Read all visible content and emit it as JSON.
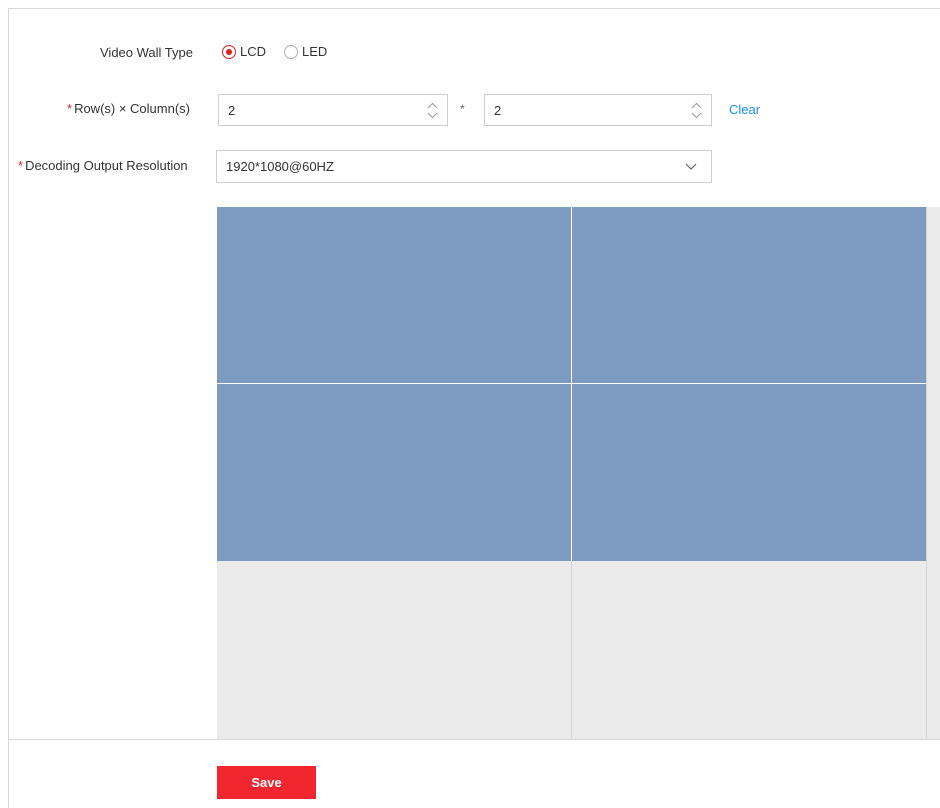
{
  "form": {
    "video_wall_type": {
      "label": "Video Wall Type",
      "options": [
        {
          "label": "LCD",
          "checked": true
        },
        {
          "label": "LED",
          "checked": false
        }
      ]
    },
    "rows_columns": {
      "required_mark": "*",
      "label": "Row(s) × Column(s)",
      "rows_value": "2",
      "separator": "*",
      "columns_value": "2",
      "clear_label": "Clear"
    },
    "decoding_output": {
      "required_mark": "*",
      "label": "Decoding Output Resolution",
      "selected": "1920*1080@60HZ"
    }
  },
  "wall": {
    "rows": 2,
    "columns": 2,
    "active_color": "#7d9bc1",
    "inactive_color": "#ebebeb"
  },
  "footer": {
    "save_label": "Save"
  },
  "colors": {
    "accent": "#f2262f",
    "link": "#1a8cff",
    "required": "#e02020"
  }
}
